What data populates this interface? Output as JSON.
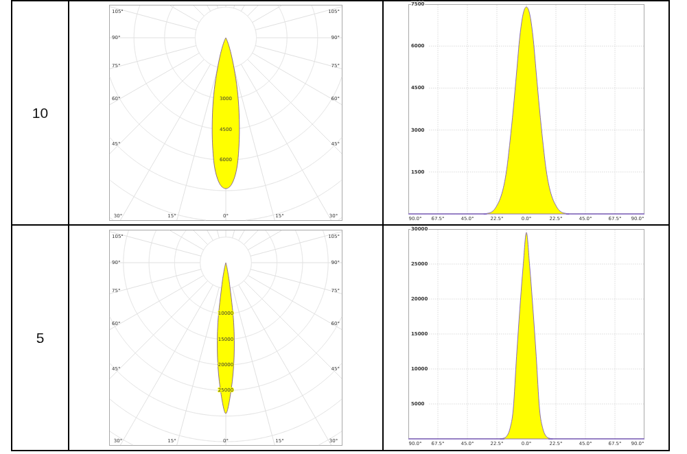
{
  "table": {
    "rows": [
      {
        "column_1": "10",
        "polar_plot": {
          "angle_labels_left": [
            "105°",
            "90°",
            "75°",
            "60°",
            "45°"
          ],
          "angle_labels_right": [
            "105°",
            "90°",
            "75°",
            "60°",
            "45°"
          ],
          "angle_labels_bottom": [
            "30°",
            "15°",
            "0°",
            "15°",
            "30°"
          ],
          "ring_labels": [
            "3000",
            "4500",
            "6000"
          ]
        },
        "linear_plot": {
          "chart_data": {
            "type": "area",
            "x": [
              -90,
              -35,
              -32.5,
              -30,
              -27.5,
              -25,
              -22.5,
              -20,
              -17.5,
              -15,
              -12.5,
              -10,
              -7.5,
              -5,
              -2.5,
              0,
              2.5,
              5,
              7.5,
              10,
              12.5,
              15,
              17.5,
              20,
              22.5,
              25,
              27.5,
              30,
              32.5,
              35,
              90
            ],
            "values": [
              0,
              0,
              0,
              20,
              50,
              130,
              300,
              550,
              950,
              1600,
              2600,
              3750,
              5050,
              6350,
              7150,
              7400,
              7150,
              6350,
              5050,
              3750,
              2600,
              1600,
              950,
              550,
              300,
              130,
              50,
              20,
              0,
              0,
              0
            ],
            "xlim": [
              -90,
              90
            ],
            "ylim": [
              0,
              7500
            ],
            "xticks": [
              {
                "value": -90,
                "label": "90.0°"
              },
              {
                "value": -67.5,
                "label": "67.5°"
              },
              {
                "value": -45,
                "label": "45.0°"
              },
              {
                "value": -22.5,
                "label": "22.5°"
              },
              {
                "value": 0,
                "label": "0.0°"
              },
              {
                "value": 22.5,
                "label": "22.5°"
              },
              {
                "value": 45,
                "label": "45.0°"
              },
              {
                "value": 67.5,
                "label": "67.5°"
              },
              {
                "value": 90,
                "label": "90.0°"
              }
            ],
            "yticks": [
              1500,
              3000,
              4500,
              6000,
              7500
            ],
            "grid": true
          }
        }
      },
      {
        "column_1": "5",
        "polar_plot": {
          "angle_labels_left": [
            "105°",
            "90°",
            "75°",
            "60°",
            "45°"
          ],
          "angle_labels_right": [
            "105°",
            "90°",
            "75°",
            "60°",
            "45°"
          ],
          "angle_labels_bottom": [
            "30°",
            "15°",
            "0°",
            "15°",
            "30°"
          ],
          "ring_labels": [
            "10000",
            "15000",
            "20000",
            "25000"
          ]
        },
        "linear_plot": {
          "chart_data": {
            "type": "area",
            "x": [
              -90,
              -22.5,
              -20,
              -17.5,
              -15,
              -12.5,
              -10,
              -7.5,
              -5,
              -2.5,
              0,
              2.5,
              5,
              7.5,
              10,
              12.5,
              15,
              17.5,
              20,
              22.5,
              90
            ],
            "values": [
              0,
              0,
              0,
              100,
              400,
              1500,
              4300,
              11800,
              18600,
              24700,
              29500,
              24700,
              18600,
              11800,
              4300,
              1500,
              400,
              100,
              0,
              0,
              0
            ],
            "xlim": [
              -90,
              90
            ],
            "ylim": [
              0,
              30000
            ],
            "xticks": [
              {
                "value": -90,
                "label": "90.0°"
              },
              {
                "value": -67.5,
                "label": "67.5°"
              },
              {
                "value": -45,
                "label": "45.0°"
              },
              {
                "value": -22.5,
                "label": "22.5°"
              },
              {
                "value": 0,
                "label": "0.0°"
              },
              {
                "value": 22.5,
                "label": "22.5°"
              },
              {
                "value": 45,
                "label": "45.0°"
              },
              {
                "value": 67.5,
                "label": "67.5°"
              },
              {
                "value": 90,
                "label": "90.0°"
              }
            ],
            "yticks": [
              5000,
              10000,
              15000,
              20000,
              25000,
              30000
            ],
            "grid": true
          }
        }
      }
    ]
  }
}
